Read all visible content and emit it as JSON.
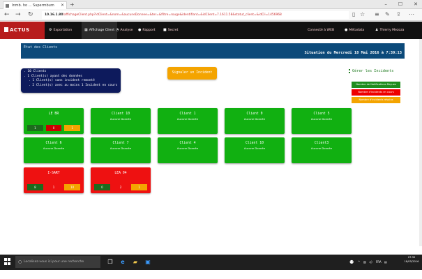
{
  "browser": {
    "tab_title": "Inmb. ho ... Supermbum",
    "url_host": "10.16.1.80",
    "url_rest": "/affichageClient.php?idClient=&nom=&aucuneDonnee=&ter=&filtre=rouge&identifiant=&idClient=7.1611.58&statut_client=&idCli=1456968",
    "controls": {
      "minimize": "–",
      "maximize": "☐",
      "close": "✕"
    },
    "nav": {
      "back": "←",
      "forward": "→",
      "refresh": "↻"
    },
    "toolbar_icons": {
      "reader": "▯",
      "favorite": "☆",
      "hub": "≡",
      "notes": "✎",
      "share": "⇪",
      "more": "⋯"
    }
  },
  "app": {
    "logo": "ACTUS",
    "nav": [
      {
        "icon": "⚙",
        "label": "Exportation"
      },
      {
        "icon": "▦",
        "label": "Affichage Client"
      },
      {
        "icon": "◔",
        "label": "Analyse"
      },
      {
        "icon": "●",
        "label": "Rapport"
      },
      {
        "icon": "■",
        "label": "Secret"
      }
    ],
    "user_items": [
      {
        "label": "Connecté à WEB"
      },
      {
        "icon": "●",
        "label": "Métadata"
      },
      {
        "icon": "♟",
        "label": "Thierry Mezoza"
      }
    ]
  },
  "header": {
    "title": "État des Clients",
    "datetime": "Situation du Mercredi 18 Mai 2016 à 7:39:13"
  },
  "summary": {
    "lines": [
      ". 10 Clients",
      ". 1 Client(s) ayant des données",
      ". 1 Client(s) sans incident remonté",
      ". 2 Client(s) avec au moins 1 Incident en cours"
    ]
  },
  "actions": {
    "report_button": "Signaler un Incident",
    "manage_link": "Gérer les Incidents"
  },
  "legend": {
    "green": "Nombre de Notifications Reçues",
    "red": "Nombre d'incidents en cours",
    "orange": "Nombre d'incidents résolus"
  },
  "clients": [
    {
      "name": "LE BR",
      "status": "",
      "color": "#11b011",
      "counts": [
        "1",
        "0",
        "1"
      ]
    },
    {
      "name": "Client 10",
      "status": "Aucune Donnée",
      "color": "#11b011",
      "counts": []
    },
    {
      "name": "Client 1",
      "status": "Aucune Donnée",
      "color": "#11b011",
      "counts": []
    },
    {
      "name": "Client 0",
      "status": "Aucune Donnée",
      "color": "#11b011",
      "counts": []
    },
    {
      "name": "Client 5",
      "status": "Aucune Donnée",
      "color": "#11b011",
      "counts": []
    },
    {
      "name": "Client 6",
      "status": "Aucune Donnée",
      "color": "#11b011",
      "counts": []
    },
    {
      "name": "Client 7",
      "status": "Aucune Donnée",
      "color": "#11b011",
      "counts": []
    },
    {
      "name": "Client 4",
      "status": "Aucune Donnée",
      "color": "#11b011",
      "counts": []
    },
    {
      "name": "Client 10",
      "status": "Aucune Donnée",
      "color": "#11b011",
      "counts": []
    },
    {
      "name": "Client3",
      "status": "Aucune Donnée",
      "color": "#11b011",
      "counts": []
    },
    {
      "name": "I-SART",
      "status": "",
      "color": "#ee1111",
      "counts": [
        "8",
        "1",
        "10"
      ]
    },
    {
      "name": "LEA 04",
      "status": "",
      "color": "#ee1111",
      "counts": [
        "0",
        "2",
        "1"
      ]
    }
  ],
  "taskbar": {
    "search_placeholder": "Localisez-vous ici pour une recherche",
    "icons": {
      "task_view": "❐",
      "edge": "e",
      "explorer": "▰",
      "store": "▣"
    },
    "tray": {
      "person": "⚉",
      "up": "^",
      "network": "▥",
      "volume": "◁)",
      "lang": "FRA",
      "notif": "▤"
    },
    "time": "07:39",
    "date": "18/05/2016"
  }
}
